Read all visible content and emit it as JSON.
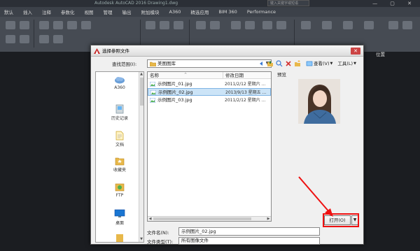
{
  "app": {
    "title": "Autodesk AutoCAD 2016    Drawing1.dwg",
    "search_placeholder": "键入关键字或短语",
    "window_buttons": "— ▢ ✕",
    "ribbon_tabs": [
      "默认",
      "插入",
      "注释",
      "参数化",
      "视图",
      "管理",
      "输出",
      "附加模块",
      "A360",
      "精选应用",
      "BIM 360",
      "Performance"
    ],
    "right_label": "位置"
  },
  "dialog": {
    "title": "选择参照文件",
    "close_label": "✕",
    "lookin_label": "查找范围(I):",
    "lookin_value": "美图图库",
    "toolbar": {
      "views_label": "查看(V)",
      "tools_label": "工具(L)"
    },
    "places": [
      {
        "label": "A360",
        "icon": "cloud-icon"
      },
      {
        "label": "历史记录",
        "icon": "history-icon"
      },
      {
        "label": "文档",
        "icon": "documents-icon"
      },
      {
        "label": "收藏夹",
        "icon": "favorites-icon"
      },
      {
        "label": "FTP",
        "icon": "ftp-icon"
      },
      {
        "label": "桌面",
        "icon": "desktop-icon"
      }
    ],
    "file_list": {
      "col_name": "名称",
      "col_date": "修改日期",
      "files": [
        {
          "name": "示例图片_01.jpg",
          "date": "2011/2/12 星期六 ...",
          "selected": false
        },
        {
          "name": "示例图片_02.jpg",
          "date": "2013/9/13 星期五 ...",
          "selected": true
        },
        {
          "name": "示例图片_03.jpg",
          "date": "2011/2/12 星期六 ...",
          "selected": false
        }
      ]
    },
    "preview_label": "预览",
    "filename_label": "文件名(N):",
    "filename_value": "示例图片_02.jpg",
    "filetype_label": "文件类型(T):",
    "filetype_value": "所有图像文件",
    "open_label": "打开(O)",
    "open_dropdown": "▼"
  },
  "colors": {
    "highlight": "#e11111",
    "selection": "#cce4f7"
  }
}
